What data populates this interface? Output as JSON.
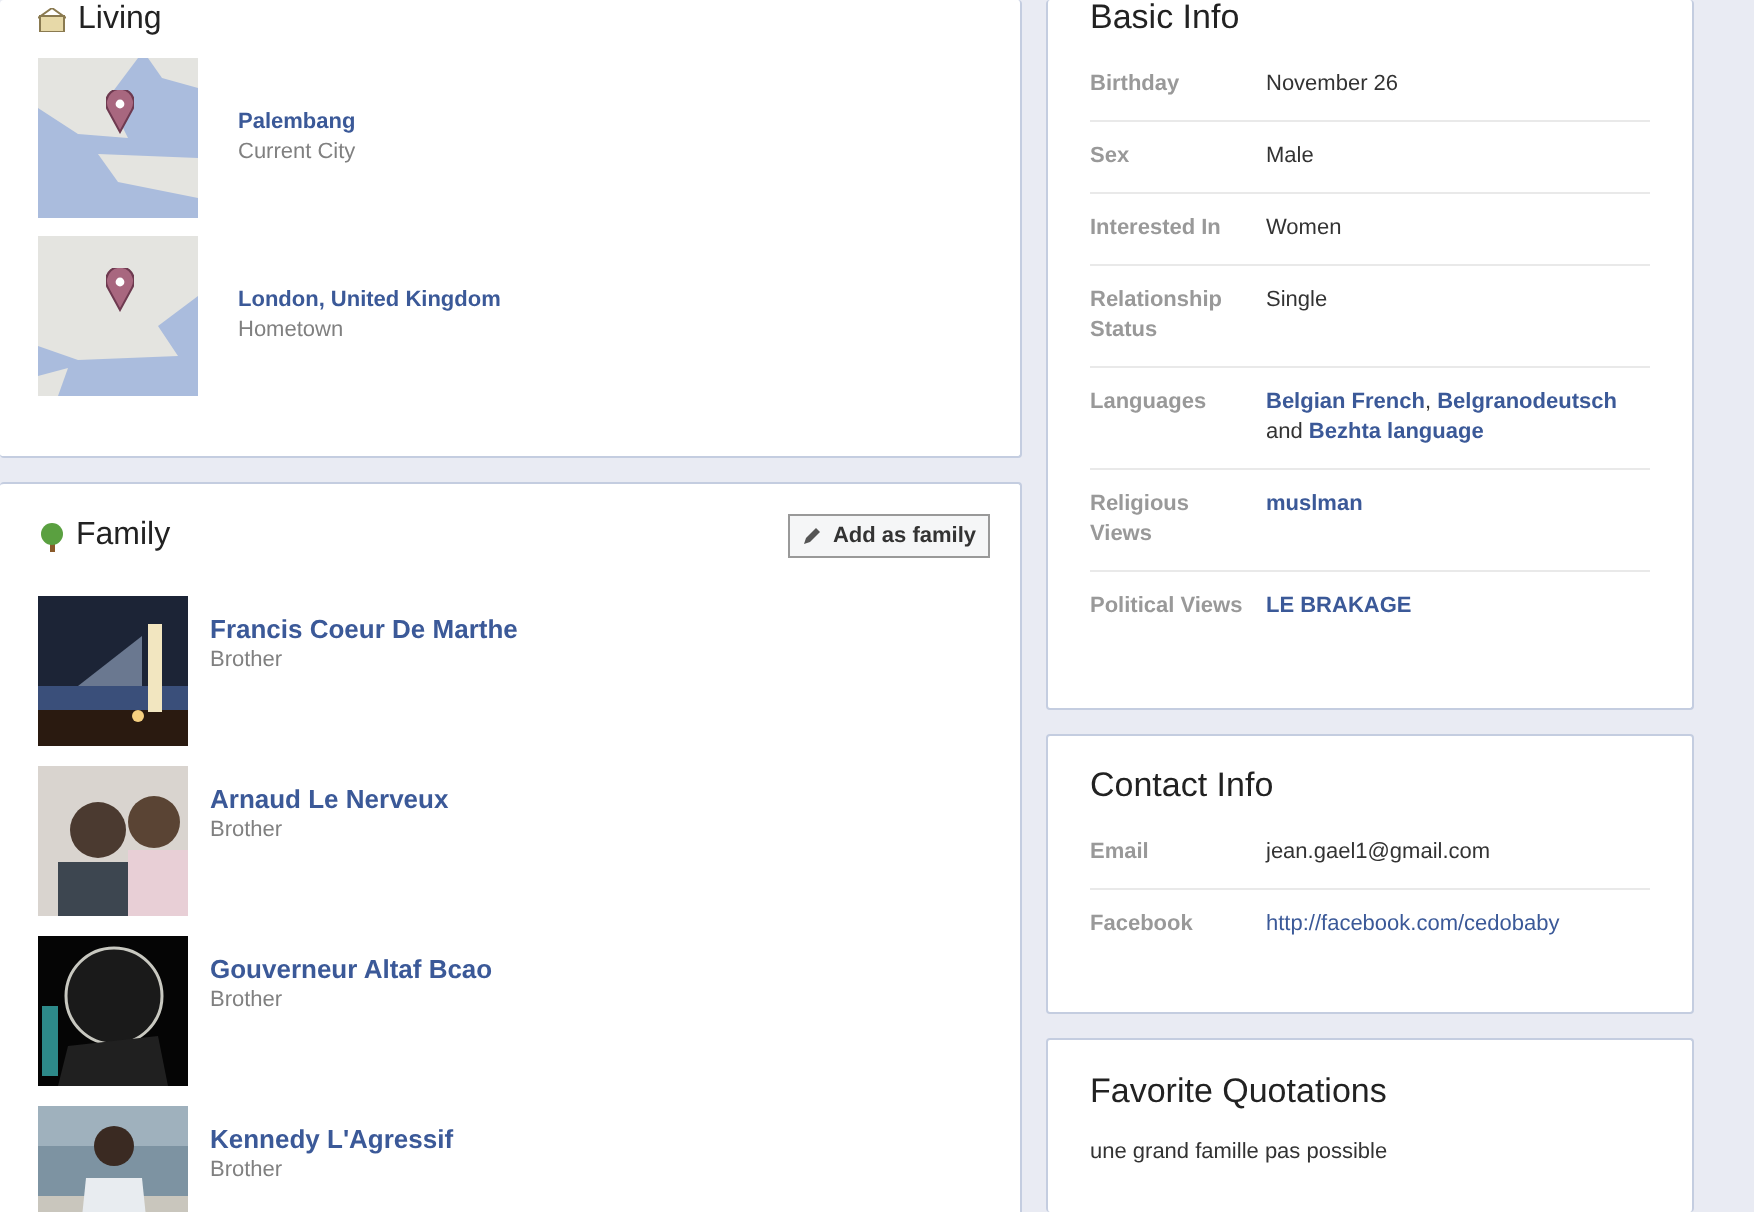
{
  "living": {
    "title": "Living",
    "places": [
      {
        "name": "Palembang",
        "role": "Current City"
      },
      {
        "name": "London, United Kingdom",
        "role": "Hometown"
      }
    ]
  },
  "family": {
    "title": "Family",
    "button": "Add as family",
    "members": [
      {
        "name": "Francis Coeur De Marthe",
        "relation": "Brother"
      },
      {
        "name": "Arnaud Le Nerveux",
        "relation": "Brother"
      },
      {
        "name": "Gouverneur Altaf Bcao",
        "relation": "Brother"
      },
      {
        "name": "Kennedy L'Agressif",
        "relation": "Brother"
      }
    ]
  },
  "basic_info": {
    "title": "Basic Info",
    "rows": [
      {
        "label": "Birthday",
        "value": [
          {
            "kind": "text",
            "text": "November 26"
          }
        ]
      },
      {
        "label": "Sex",
        "value": [
          {
            "kind": "text",
            "text": "Male"
          }
        ]
      },
      {
        "label": "Interested In",
        "value": [
          {
            "kind": "text",
            "text": "Women"
          }
        ]
      },
      {
        "label": "Relationship Status",
        "value": [
          {
            "kind": "text",
            "text": "Single"
          }
        ]
      },
      {
        "label": "Languages",
        "value": [
          {
            "kind": "link",
            "text": "Belgian French"
          },
          {
            "kind": "text",
            "text": ","
          },
          {
            "kind": "link",
            "text": "Belgranodeutsch"
          },
          {
            "kind": "text",
            "text": "and"
          },
          {
            "kind": "link",
            "text": "Bezhta language"
          }
        ]
      },
      {
        "label": "Religious Views",
        "value": [
          {
            "kind": "link",
            "text": "muslman"
          }
        ]
      },
      {
        "label": "Political Views",
        "value": [
          {
            "kind": "link",
            "text": "LE BRAKAGE"
          }
        ]
      }
    ]
  },
  "contact_info": {
    "title": "Contact Info",
    "rows": [
      {
        "label": "Email",
        "value": [
          {
            "kind": "text",
            "text": "jean.gael1@gmail.com"
          }
        ]
      },
      {
        "label": "Facebook",
        "value": [
          {
            "kind": "url",
            "text": "http://facebook.com/cedobaby"
          }
        ]
      }
    ]
  },
  "favorite_quotations": {
    "title": "Favorite Quotations",
    "text": "une grand famille pas possible"
  }
}
